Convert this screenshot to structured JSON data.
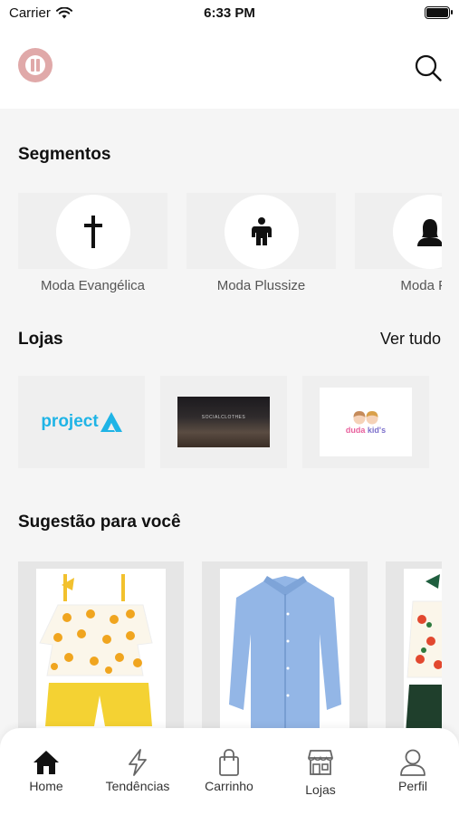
{
  "status_bar": {
    "carrier": "Carrier",
    "time": "6:33 PM"
  },
  "header": {
    "logo_icon": "pause-logo-icon",
    "search_icon": "search-icon"
  },
  "segments": {
    "title": "Segmentos",
    "items": [
      {
        "label": "Moda Evangélica",
        "icon": "cross-icon"
      },
      {
        "label": "Moda Plussize",
        "icon": "plus-size-person-icon"
      },
      {
        "label": "Moda Fer",
        "icon": "woman-icon"
      }
    ]
  },
  "stores": {
    "title": "Lojas",
    "see_all": "Ver tudo",
    "items": [
      {
        "name": "project"
      },
      {
        "name": "SOCIALCLOTHES"
      },
      {
        "name": "duda kid's"
      }
    ]
  },
  "suggestions": {
    "title": "Sugestão para você",
    "items": [
      {
        "description": "yellow-orange-print-outfit"
      },
      {
        "description": "light-blue-shirt"
      },
      {
        "description": "floral-outfit"
      }
    ]
  },
  "nav": {
    "items": [
      {
        "label": "Home",
        "icon": "home-icon",
        "active": true
      },
      {
        "label": "Tendências",
        "icon": "lightning-icon"
      },
      {
        "label": "Carrinho",
        "icon": "bag-icon"
      },
      {
        "label": "Lojas",
        "icon": "store-icon"
      },
      {
        "label": "Perfil",
        "icon": "user-icon"
      }
    ]
  },
  "colors": {
    "accent": "#e0a9a9",
    "project_blue": "#1fb4e6",
    "background": "#f5f5f5"
  }
}
